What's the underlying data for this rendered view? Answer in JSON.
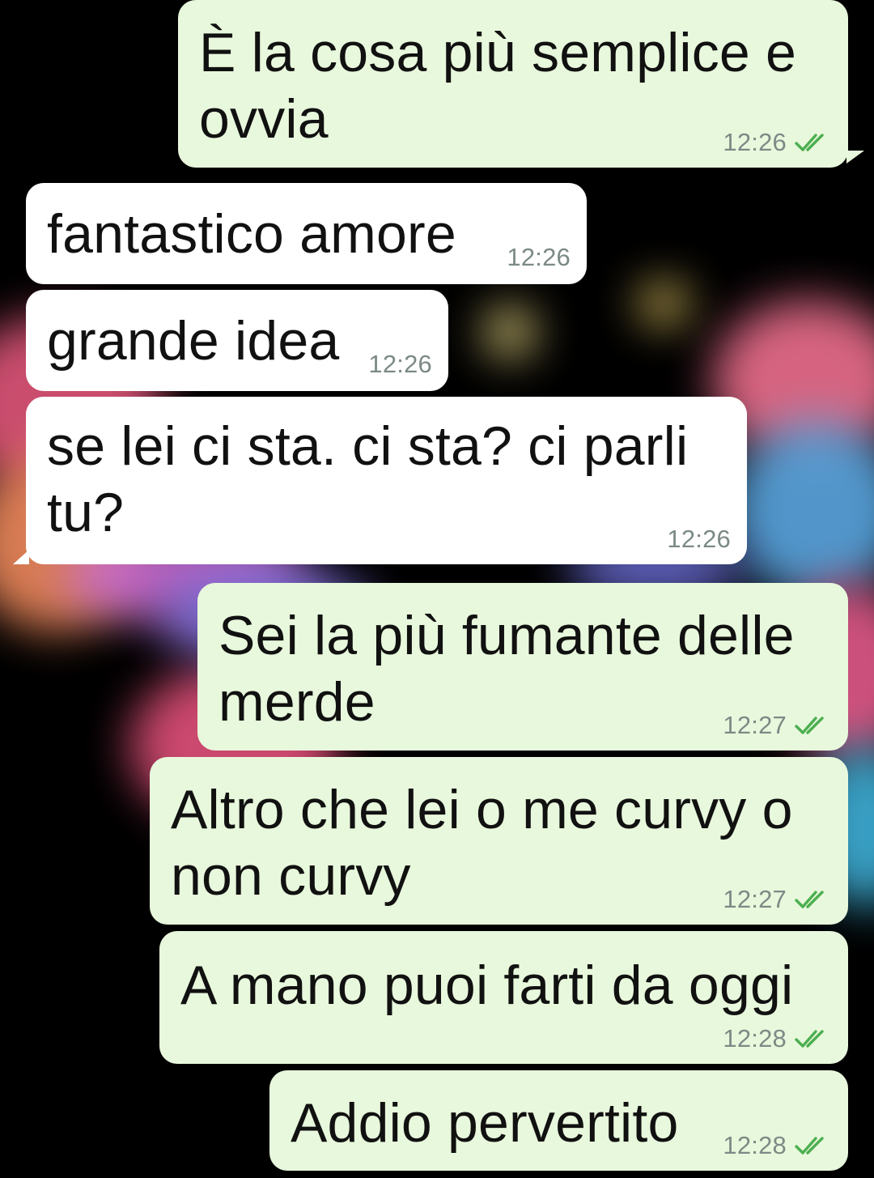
{
  "chat": {
    "messages": [
      {
        "direction": "out",
        "text": "È la cosa più semplice e\novvia",
        "time": "12:26",
        "status": "read-double-check"
      },
      {
        "direction": "in",
        "text": "fantastico amore",
        "time": "12:26"
      },
      {
        "direction": "in",
        "text": "grande idea",
        "time": "12:26"
      },
      {
        "direction": "in",
        "text": "se lei ci sta. ci sta? ci parli\ntu?",
        "time": "12:26"
      },
      {
        "direction": "out",
        "text": "Sei la più fumante delle\nmerde",
        "time": "12:27",
        "status": "read-double-check"
      },
      {
        "direction": "out",
        "text": "Altro che lei o me curvy o\nnon curvy",
        "time": "12:27",
        "status": "read-double-check"
      },
      {
        "direction": "out",
        "text": "A mano puoi farti da oggi",
        "time": "12:28",
        "status": "read-double-check"
      },
      {
        "direction": "out",
        "text": "Addio pervertito",
        "time": "12:28",
        "status": "read-double-check"
      }
    ]
  },
  "colors": {
    "outgoing_bubble": "#e8f8dc",
    "incoming_bubble": "#ffffff",
    "timestamp": "#7c8a86",
    "check_icon": "#4caf50",
    "wallpaper_base": "#000000"
  }
}
